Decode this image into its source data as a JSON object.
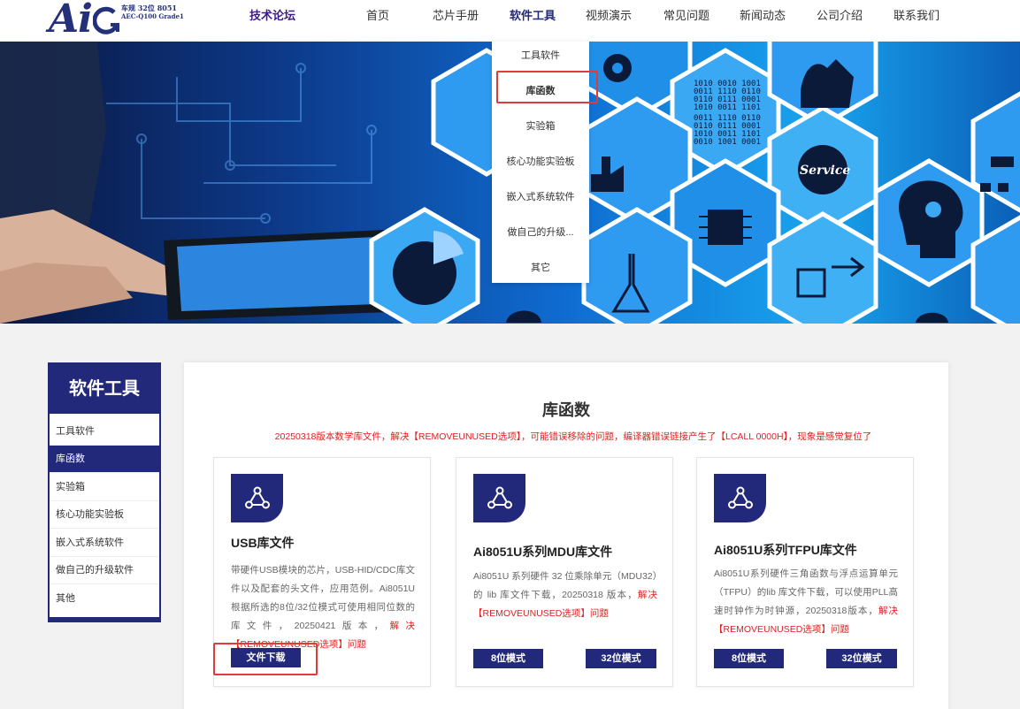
{
  "header": {
    "logo": {
      "main": "Ai",
      "sub1": "车规 32位 8051",
      "sub2": "AEC-Q100 Grade1"
    },
    "forum": "技术论坛",
    "nav": [
      "首页",
      "芯片手册",
      "软件工具",
      "视频演示",
      "常见问题",
      "新闻动态",
      "公司介绍",
      "联系我们"
    ],
    "nav_active": "软件工具"
  },
  "hero": {
    "binary_lines": [
      "1010 0010 1001",
      "0011 1110 0110",
      "0110 0111 0001",
      "1010 0011 1101",
      "0011 1110 0110",
      "0110 0111 0001",
      "1010 0011 1101",
      "0010 1001 0001"
    ],
    "service_text": "Service"
  },
  "dropdown": {
    "items": [
      "工具软件",
      "库函数",
      "实验箱",
      "核心功能实验板",
      "嵌入式系统软件",
      "做自己的升级...",
      "其它"
    ],
    "selected": "库函数"
  },
  "sidebar": {
    "title": "软件工具",
    "items": [
      "工具软件",
      "库函数",
      "实验箱",
      "核心功能实验板",
      "嵌入式系统软件",
      "做自己的升级软件",
      "其他"
    ],
    "active": "库函数"
  },
  "main": {
    "title": "库函数",
    "notice": "20250318版本数学库文件，解决【REMOVEUNUSED选项】，可能错误移除的问题，编译器错误链接产生了【LCALL 0000H】，现象是感觉复位了",
    "cards": [
      {
        "icon": "share-network-icon",
        "title": "USB库文件",
        "desc": "带硬件USB模块的芯片，USB-HID/CDC库文件以及配套的头文件，应用范例。Ai8051U根据所选的8位/32位模式可使用相同位数的库文件，20250421版本，",
        "desc_red": "解决【REMOVEUNUSED选项】问题",
        "buttons": [
          "文件下载"
        ]
      },
      {
        "icon": "share-network-icon",
        "title": "Ai8051U系列MDU库文件",
        "desc": "Ai8051U 系列硬件 32 位乘除单元（MDU32）的 lib 库文件下载，20250318 版本，",
        "desc_red": "解决【REMOVEUNUSED选项】问题",
        "buttons": [
          "8位模式",
          "32位模式"
        ]
      },
      {
        "icon": "share-network-icon",
        "title": "Ai8051U系列TFPU库文件",
        "desc": "Ai8051U系列硬件三角函数与浮点运算单元（TFPU）的lib 库文件下载，可以使用PLL高速时钟作为时钟源，20250318版本，",
        "desc_red": "解决【REMOVEUNUSED选项】问题",
        "buttons": [
          "8位模式",
          "32位模式"
        ]
      }
    ]
  },
  "colors": {
    "brand": "#23297a",
    "highlight": "#e03b3b",
    "notice": "#e02020"
  }
}
